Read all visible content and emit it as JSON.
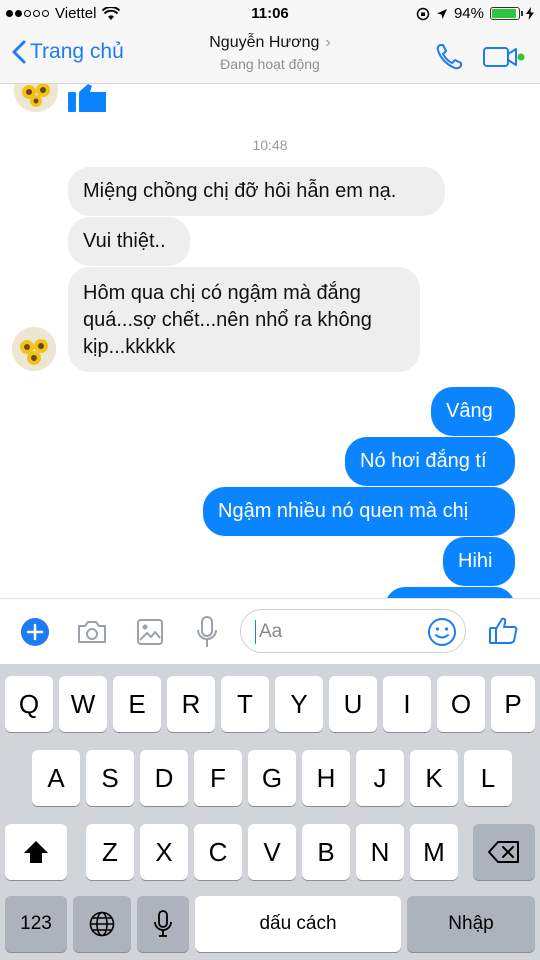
{
  "status_bar": {
    "carrier": "Viettel",
    "time": "11:06",
    "battery_percent": "94%",
    "battery_level": 0.94,
    "signal_bars_filled": 2,
    "signal_bars_total": 5
  },
  "header": {
    "back_label": "Trang chủ",
    "contact_name": "Nguyễn Hương",
    "status_text": "Đang hoạt động",
    "icons": [
      "phone-icon",
      "video-call-icon"
    ],
    "accent_color": "#1e7cf2"
  },
  "chat": {
    "timestamp": "10:48",
    "received": [
      {
        "text": "Miệng chồng chị đỡ hôi hẫn em nạ."
      },
      {
        "text": "Vui thiệt.."
      },
      {
        "lines": [
          "Hôm qua chị có ngậm mà đắng",
          "quá...sợ chết...nên nhổ ra không",
          "kịp...kkkkk"
        ]
      }
    ],
    "sent": [
      {
        "text": "Vâng"
      },
      {
        "text": "Nó hơi đắng tí"
      },
      {
        "text": "Ngậm nhiều nó quen mà chị"
      },
      {
        "text": "Hihi"
      }
    ],
    "sent_color": "#0b84ff",
    "received_color": "#eeeeee"
  },
  "composer": {
    "placeholder": "Aa",
    "icons": [
      "plus-icon",
      "camera-icon",
      "image-icon",
      "microphone-icon",
      "emoji-icon",
      "thumbs-up-icon"
    ]
  },
  "keyboard": {
    "row1": [
      "Q",
      "W",
      "E",
      "R",
      "T",
      "Y",
      "U",
      "I",
      "O",
      "P"
    ],
    "row2": [
      "A",
      "S",
      "D",
      "F",
      "G",
      "H",
      "J",
      "K",
      "L"
    ],
    "row3": [
      "Z",
      "X",
      "C",
      "V",
      "B",
      "N",
      "M"
    ],
    "numbers_key": "123",
    "space_label": "dấu cách",
    "return_label": "Nhập"
  }
}
